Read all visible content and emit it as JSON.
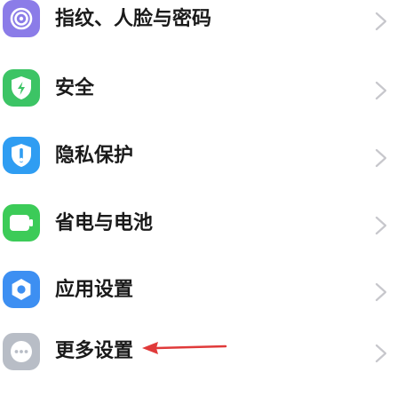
{
  "settings": {
    "items": [
      {
        "label": "指纹、人脸与密码",
        "icon": "fingerprint-icon",
        "color": "#8b7ce8"
      },
      {
        "label": "安全",
        "icon": "shield-bolt-icon",
        "color": "#3cc465"
      },
      {
        "label": "隐私保护",
        "icon": "privacy-shield-icon",
        "color": "#2f9df2"
      },
      {
        "label": "省电与电池",
        "icon": "battery-icon",
        "color": "#3ccb58"
      },
      {
        "label": "应用设置",
        "icon": "gear-icon",
        "color": "#3d8ff2"
      },
      {
        "label": "更多设置",
        "icon": "more-dots-icon",
        "color": "#b8bdc6"
      }
    ],
    "chevron_color": "#c7c7cc",
    "annotation_arrow_color": "#e03a3a"
  }
}
